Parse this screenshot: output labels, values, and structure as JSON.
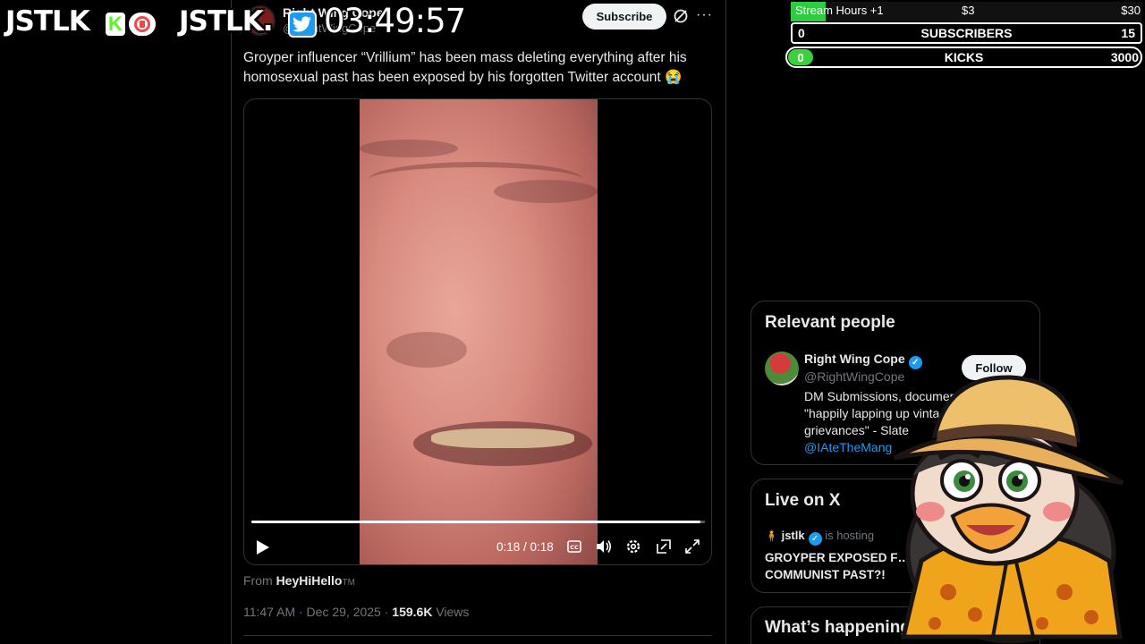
{
  "overlay": {
    "logo_text_1": "JSTLK",
    "kick_badge": "K",
    "logo_text_2": "JSTLK.",
    "timer": "03:49:57"
  },
  "goals": {
    "stream_hours_label": "Stream Hours +1",
    "stream_hours_mid": "$3",
    "stream_hours_end": "$30",
    "stream_hours_progress": 0.1,
    "subscribers_current": "0",
    "subscribers_label": "SUBSCRIBERS",
    "subscribers_goal": "15",
    "kicks_current": "0",
    "kicks_label": "KICKS",
    "kicks_goal": "3000"
  },
  "tweet": {
    "author_name": "Right Wing Cope",
    "author_handle": "@RightWingCope",
    "subscribe_label": "Subscribe",
    "more_label": "···",
    "text": "Groyper influencer “Vrillium” has been mass deleting everything after his homosexual past has been exposed by his forgotten Twitter account 😭",
    "video": {
      "time": "0:18 / 0:18",
      "progress": 0.99
    },
    "from_prefix": "From",
    "from_source": "HeyHiHello",
    "from_suffix": "TM",
    "timestamp": "11:47 AM · Dec 29, 2025 ·",
    "views_count": "159.6K",
    "views_label": "Views"
  },
  "sidebar": {
    "relevant_title": "Relevant people",
    "relevant_person": {
      "name": "Right Wing Cope",
      "handle": "@RightWingCope",
      "follow_label": "Follow",
      "bio_line1": "DM Submissions, documer",
      "bio_line2": "\"happily lapping up vinta",
      "bio_line3": "grievances\" - Slate",
      "bio_link": "@IAteTheMang"
    },
    "live_title": "Live on X",
    "live_host": "jstlk",
    "live_host_suffix": "is hosting",
    "live_stream_title": "GROYPER EXPOSED F… COMMUNIST PAST?!",
    "happening_title": "What’s happening"
  },
  "colors": {
    "accent_blue": "#1d9bf0",
    "kick_green": "#53fc18",
    "goal_green": "#2ecc40"
  }
}
